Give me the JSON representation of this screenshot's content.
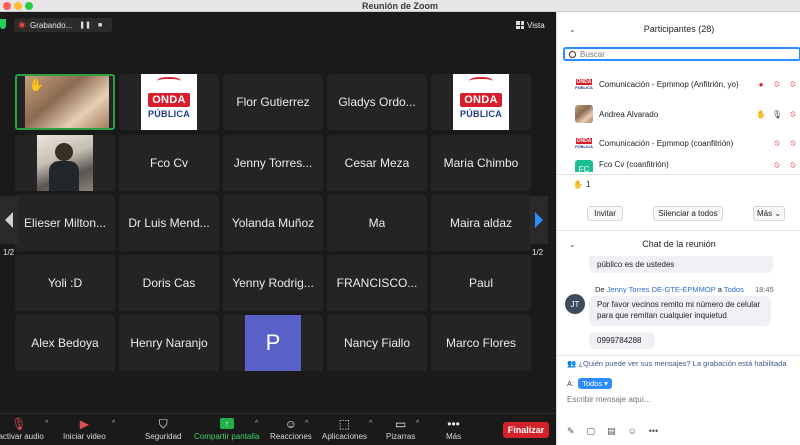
{
  "window": {
    "title": "Reunión de Zoom"
  },
  "video": {
    "recording_label": "Grabando...",
    "view_label": "Vista",
    "page_indicator": "1/2",
    "tiles": [
      {
        "type": "photo",
        "name": "",
        "active": true,
        "emoji": "✋"
      },
      {
        "type": "logo",
        "name": ""
      },
      {
        "type": "name",
        "name": "Flor Gutierrez"
      },
      {
        "type": "name",
        "name": "Gladys Ordo..."
      },
      {
        "type": "logo",
        "name": ""
      },
      {
        "type": "photo2",
        "name": ""
      },
      {
        "type": "name",
        "name": "Fco Cv"
      },
      {
        "type": "name",
        "name": "Jenny Torres..."
      },
      {
        "type": "name",
        "name": "Cesar Meza"
      },
      {
        "type": "name",
        "name": "Maria Chimbo"
      },
      {
        "type": "name",
        "name": "Elieser Milton..."
      },
      {
        "type": "name",
        "name": "Dr Luis Mend..."
      },
      {
        "type": "name",
        "name": "Yolanda Muñoz"
      },
      {
        "type": "name",
        "name": "Ma"
      },
      {
        "type": "name",
        "name": "Maira aldaz"
      },
      {
        "type": "name",
        "name": "Yoli :D"
      },
      {
        "type": "name",
        "name": "Doris Cas"
      },
      {
        "type": "name",
        "name": "Yenny Rodrig..."
      },
      {
        "type": "name",
        "name": "FRANCISCO..."
      },
      {
        "type": "name",
        "name": "Paul"
      },
      {
        "type": "name",
        "name": "Alex Bedoya"
      },
      {
        "type": "name",
        "name": "Henry Naranjo"
      },
      {
        "type": "avatar",
        "name": "",
        "letter": "P"
      },
      {
        "type": "name",
        "name": "Nancy Fiallo"
      },
      {
        "type": "name",
        "name": "Marco Flores"
      }
    ],
    "logo": {
      "line1": "ONDA",
      "line2": "PÚBLICA"
    }
  },
  "toolbar": {
    "audio": "eactivar audio",
    "video": "Iniciar video",
    "security": "Seguridad",
    "share": "Compartir pantalla",
    "reactions": "Reacciones",
    "apps": "Aplicaciones",
    "whiteboards": "Pizarras",
    "more": "Más",
    "end": "Finalizar"
  },
  "participants": {
    "header": "Participantes (28)",
    "search_placeholder": "Buscar",
    "rows": [
      {
        "name": "Comunicación - Epmmop (Anfitrión, yo)",
        "avatar": "logo"
      },
      {
        "name": "Andrea Alvarado",
        "avatar": "photo"
      },
      {
        "name": "Comunicación - Epmmop (coanfitrión)",
        "avatar": "logo"
      },
      {
        "name": "Fco Cv (coanfitrión)",
        "avatar": "FC"
      }
    ],
    "raised_hands": "1",
    "invite": "Invitar",
    "mute_all": "Silenciar a todos",
    "more": "Más"
  },
  "chat": {
    "header": "Chat de la reunión",
    "prev_message_tail": "público es de ustedes",
    "from_label": "De",
    "sender": "Jenny Torres DE-GTE-EPMMOP",
    "to_word": "a",
    "recipient": "Todos",
    "time": "18:45",
    "sender_initials": "JT",
    "message": "Por favor vecinos remito mi número de celular para que remitan cualquier inquietud",
    "message2": "0999784288",
    "notice": "¿Quién puede ver sus mensajes? La grabación está habilitada",
    "to_label": "A:",
    "to_value": "Todos",
    "compose_placeholder": "Escribir mensaje aquí..."
  }
}
